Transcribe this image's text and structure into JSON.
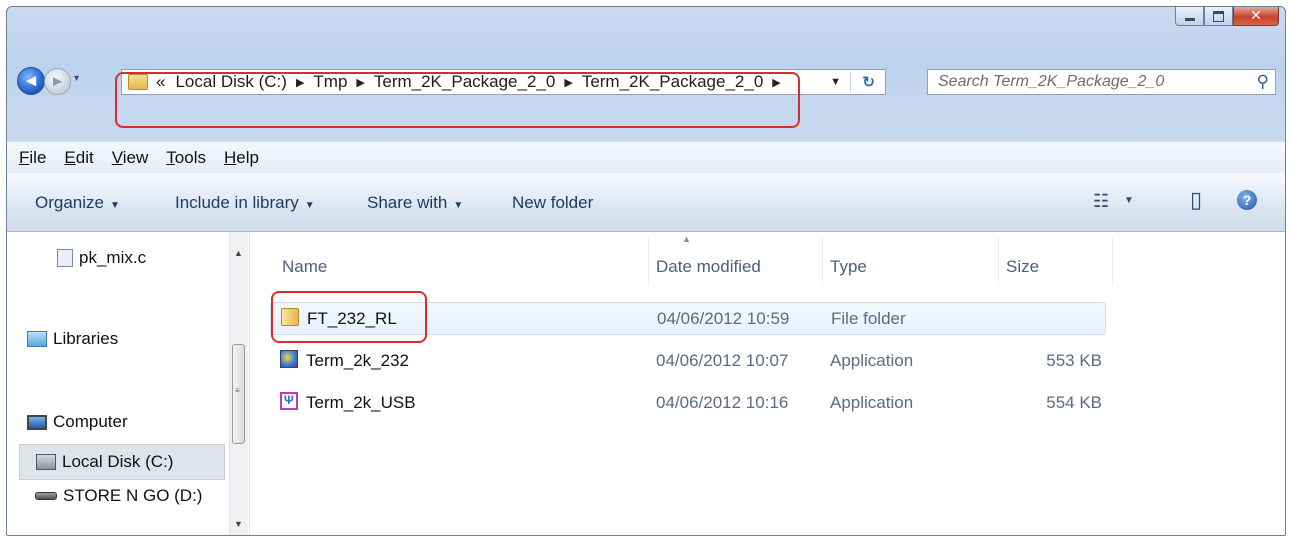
{
  "window": {
    "minimize_icon": "minimize-icon",
    "maximize_icon": "maximize-icon",
    "close_glyph": "✕"
  },
  "nav": {
    "back_glyph": "◄",
    "forward_glyph": "►",
    "recent_glyph": "▾"
  },
  "address": {
    "overflow": "«",
    "crumbs": [
      "Local Disk (C:)",
      "Tmp",
      "Term_2K_Package_2_0",
      "Term_2K_Package_2_0"
    ],
    "separator": "▶",
    "dropdown_glyph": "▼",
    "refresh_glyph": "↻"
  },
  "search": {
    "placeholder": "Search Term_2K_Package_2_0",
    "icon_glyph": "⚲"
  },
  "menubar": [
    "File",
    "Edit",
    "View",
    "Tools",
    "Help"
  ],
  "toolbar": {
    "organize": "Organize",
    "include": "Include in library",
    "share": "Share with",
    "new_folder": "New folder",
    "arrow": "▼",
    "views_glyph": "☷",
    "views_arrow": "▼",
    "preview_glyph": "▯",
    "help_glyph": "?"
  },
  "navpane": {
    "items": [
      {
        "label": "pk_mix.c",
        "icon": "c-file-icon"
      },
      {
        "label": "Libraries",
        "icon": "libraries-icon"
      },
      {
        "label": "Computer",
        "icon": "computer-icon"
      },
      {
        "label": "Local Disk (C:)",
        "icon": "local-disk-icon",
        "selected": true
      },
      {
        "label": "STORE N GO (D:)",
        "icon": "usb-drive-icon"
      }
    ],
    "scroll_up": "▲",
    "scroll_down": "▼",
    "grip": "≡"
  },
  "columns": {
    "name": "Name",
    "date": "Date modified",
    "type": "Type",
    "size": "Size",
    "sort_glyph": "▲"
  },
  "files": [
    {
      "name": "FT_232_RL",
      "date": "04/06/2012 10:59",
      "type": "File folder",
      "size": "",
      "icon": "folder-icon",
      "selected": true
    },
    {
      "name": "Term_2k_232",
      "date": "04/06/2012 10:07",
      "type": "Application",
      "size": "553 KB",
      "icon": "application-icon"
    },
    {
      "name": "Term_2k_USB",
      "date": "04/06/2012 10:16",
      "type": "Application",
      "size": "554 KB",
      "icon": "usb-application-icon"
    }
  ],
  "colors": {
    "highlight_box": "#d92c2c",
    "selection": "#e7f0fb"
  }
}
